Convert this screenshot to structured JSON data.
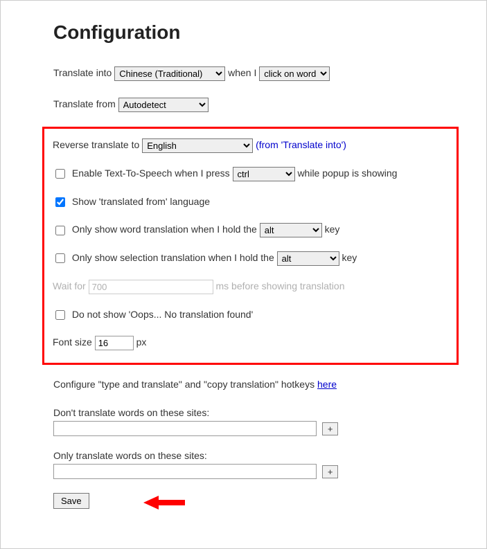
{
  "title": "Configuration",
  "translate_into": {
    "label_before": "Translate into",
    "selected": "Chinese (Traditional)",
    "when_i": "when I",
    "trigger_selected": "click on word"
  },
  "translate_from": {
    "label": "Translate from",
    "selected": "Autodetect"
  },
  "reverse": {
    "label": "Reverse translate to",
    "selected": "English",
    "note": "(from 'Translate into')"
  },
  "tts": {
    "label_before": "Enable Text-To-Speech when I press",
    "selected": "ctrl",
    "label_after": "while popup is showing"
  },
  "show_translated_from": {
    "label": "Show 'translated from' language",
    "checked": true
  },
  "only_word": {
    "label_before": "Only show word translation when I hold the",
    "selected": "alt",
    "label_after": "key"
  },
  "only_selection": {
    "label_before": "Only show selection translation when I hold the",
    "selected": "alt",
    "label_after": "key"
  },
  "wait": {
    "label_before": "Wait for",
    "value": "700",
    "label_after": "ms before showing translation"
  },
  "no_oops": {
    "label": "Do not show 'Oops... No translation found'"
  },
  "fontsize": {
    "label_before": "Font size",
    "value": "16",
    "label_after": "px"
  },
  "hotkeys_text": "Configure \"type and translate\" and \"copy translation\" hotkeys ",
  "hotkeys_link": "here",
  "dont_translate_label": "Don't translate words on these sites:",
  "only_translate_label": "Only translate words on these sites:",
  "plus": "+",
  "save": "Save"
}
